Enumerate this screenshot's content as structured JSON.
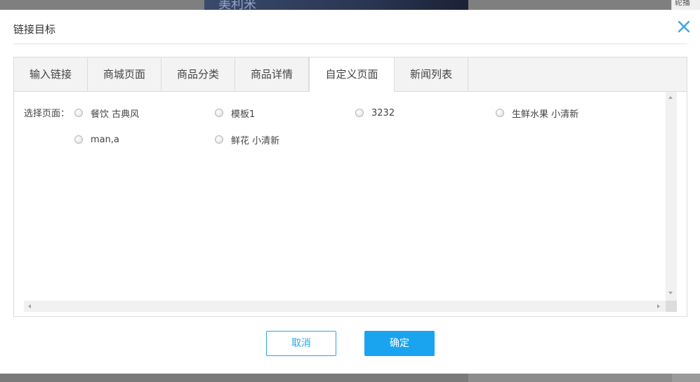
{
  "background": {
    "banner_text": "美利米",
    "right_tab_text": "轮播"
  },
  "dialog": {
    "title": "链接目标",
    "close_icon": "close-icon",
    "accent_color": "#1aa4f0"
  },
  "tabs": [
    {
      "label": "输入链接",
      "active": false
    },
    {
      "label": "商城页面",
      "active": false
    },
    {
      "label": "商品分类",
      "active": false
    },
    {
      "label": "商品详情",
      "active": false
    },
    {
      "label": "自定义页面",
      "active": true
    },
    {
      "label": "新闻列表",
      "active": false
    }
  ],
  "custom_page": {
    "select_label": "选择页面：",
    "options": [
      {
        "label": "餐饮 古典风",
        "selected": false
      },
      {
        "label": "模板1",
        "selected": false
      },
      {
        "label": "3232",
        "selected": false
      },
      {
        "label": "生鲜水果 小清新",
        "selected": false
      },
      {
        "label": "man,a",
        "selected": false
      },
      {
        "label": "鲜花 小清新",
        "selected": false
      }
    ]
  },
  "buttons": {
    "cancel": "取消",
    "confirm": "确定"
  }
}
